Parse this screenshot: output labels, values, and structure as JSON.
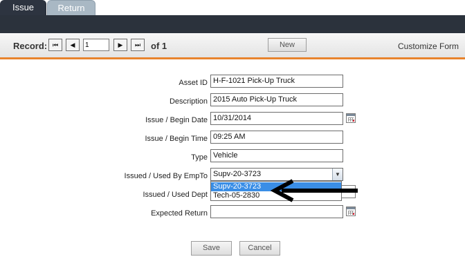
{
  "tabs": [
    {
      "label": "Issue",
      "active": true
    },
    {
      "label": "Return",
      "active": false
    }
  ],
  "toolbar": {
    "record_label": "Record:",
    "record_value": "1",
    "of_label": "of 1",
    "new_label": "New",
    "customize_label": "Customize Form",
    "accent_color": "#e8832c"
  },
  "form": {
    "asset_id": {
      "label": "Asset ID",
      "value": "H-F-1021 Pick-Up Truck"
    },
    "description": {
      "label": "Description",
      "value": "2015 Auto Pick-Up Truck"
    },
    "begin_date": {
      "label": "Issue / Begin Date",
      "value": "10/31/2014"
    },
    "begin_time": {
      "label": "Issue / Begin Time",
      "value": "09:25 AM"
    },
    "type": {
      "label": "Type",
      "value": "Vehicle"
    },
    "issued_by": {
      "label": "Issued / Used By EmpTo",
      "value": "Supv-20-3723",
      "options": [
        "Supv-20-3723",
        "Tech-05-2830"
      ]
    },
    "issued_dept": {
      "label": "Issued / Used Dept",
      "value": ""
    },
    "expected_return": {
      "label": "Expected Return",
      "value": ""
    }
  },
  "actions": {
    "save_label": "Save",
    "cancel_label": "Cancel"
  },
  "icons": {
    "calendar": "calendar-icon",
    "first": "first-record-icon",
    "prev": "previous-record-icon",
    "next": "next-record-icon",
    "last": "last-record-icon"
  }
}
